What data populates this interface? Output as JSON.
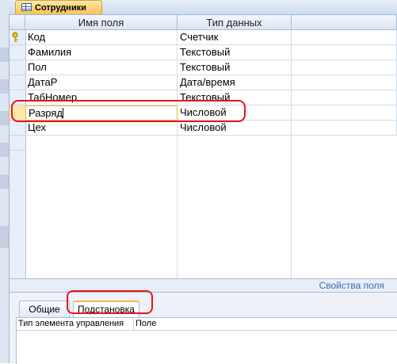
{
  "document_tab": {
    "title": "Сотрудники"
  },
  "grid": {
    "headers": {
      "name": "Имя поля",
      "type": "Тип данных"
    },
    "rows": [
      {
        "name": "Код",
        "type": "Счетчик",
        "key": true
      },
      {
        "name": "Фамилия",
        "type": "Текстовый"
      },
      {
        "name": "Пол",
        "type": "Текстовый"
      },
      {
        "name": "ДатаР",
        "type": "Дата/время"
      },
      {
        "name": "ТабНомер",
        "type": "Текстовый"
      },
      {
        "name": "Разряд",
        "type": "Числовой",
        "current": true
      },
      {
        "name": "Цех",
        "type": "Числовой"
      }
    ]
  },
  "properties": {
    "label": "Свойства поля",
    "tabs": [
      {
        "label": "Общие"
      },
      {
        "label": "Подстановка",
        "active": true
      }
    ],
    "rows": [
      {
        "key": "Тип элемента управления",
        "value": "Поле"
      }
    ]
  }
}
